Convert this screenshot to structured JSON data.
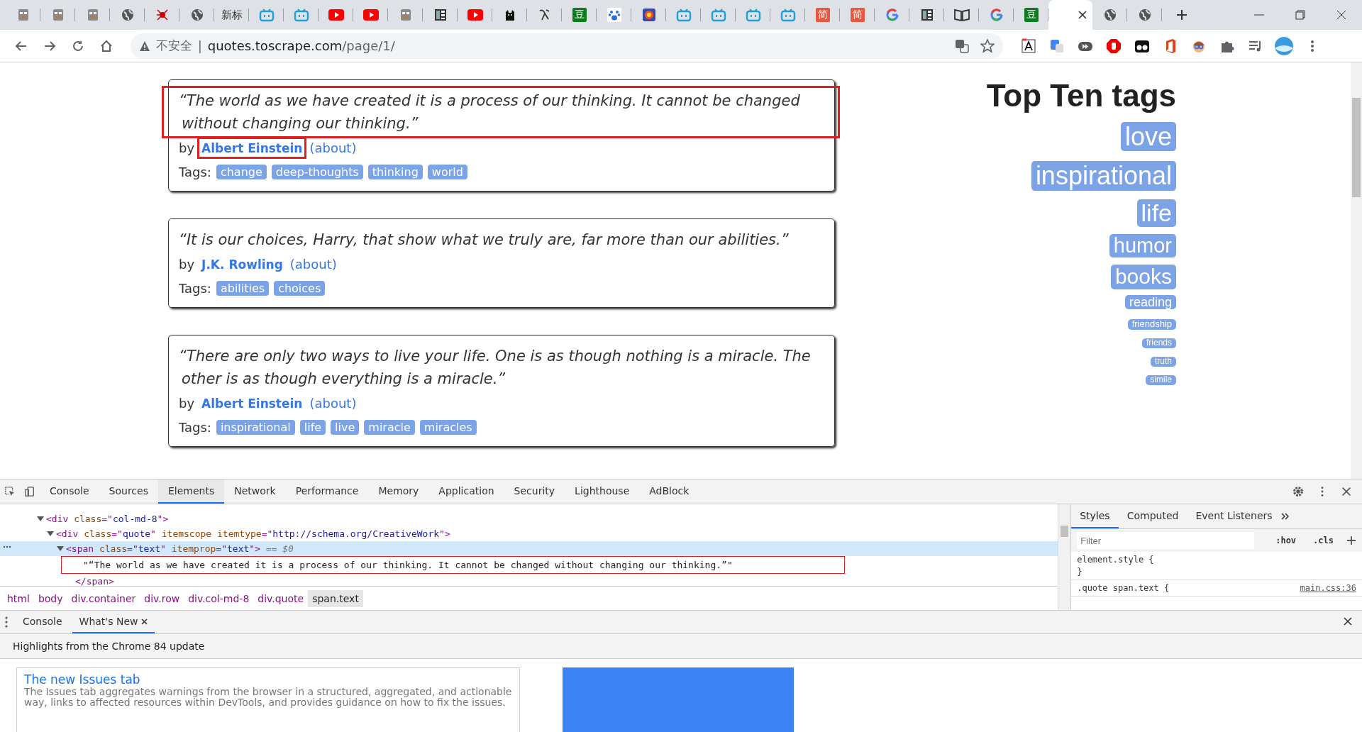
{
  "browser": {
    "tabs": [
      {
        "kind": "pixel",
        "selected": false
      },
      {
        "kind": "pixel",
        "selected": false
      },
      {
        "kind": "pixel",
        "selected": false
      },
      {
        "kind": "globe",
        "selected": false
      },
      {
        "kind": "spider",
        "selected": false
      },
      {
        "kind": "globe",
        "selected": false
      },
      {
        "kind": "text",
        "label": "新标",
        "selected": false
      },
      {
        "kind": "tv",
        "selected": false
      },
      {
        "kind": "tv",
        "selected": false
      },
      {
        "kind": "youtube",
        "selected": false
      },
      {
        "kind": "youtube",
        "selected": false
      },
      {
        "kind": "pixel",
        "selected": false
      },
      {
        "kind": "panel",
        "selected": false
      },
      {
        "kind": "youtube",
        "selected": false
      },
      {
        "kind": "cat",
        "selected": false
      },
      {
        "kind": "person",
        "selected": false
      },
      {
        "kind": "glyph",
        "glyph": "豆",
        "color": "#0a7d1c",
        "selected": false
      },
      {
        "kind": "paw",
        "selected": false
      },
      {
        "kind": "colorful",
        "selected": false
      },
      {
        "kind": "tv",
        "selected": false
      },
      {
        "kind": "tv",
        "selected": false
      },
      {
        "kind": "tv",
        "selected": false
      },
      {
        "kind": "tv",
        "selected": false
      },
      {
        "kind": "glyph",
        "glyph": "简",
        "color": "#e8573f",
        "selected": false
      },
      {
        "kind": "glyph",
        "glyph": "简",
        "color": "#e8573f",
        "selected": false
      },
      {
        "kind": "google",
        "selected": false
      },
      {
        "kind": "panel",
        "selected": false
      },
      {
        "kind": "openbook",
        "selected": false
      },
      {
        "kind": "google",
        "selected": false
      },
      {
        "kind": "glyph",
        "glyph": "豆",
        "color": "#0a7d1c",
        "selected": false
      },
      {
        "kind": "blank",
        "selected": true
      },
      {
        "kind": "globe",
        "selected": false
      },
      {
        "kind": "globe",
        "selected": false
      }
    ],
    "address": {
      "security": "不安全",
      "separator": "|",
      "host": "quotes.toscrape.com",
      "path": "/page/1/"
    },
    "extensions": [
      {
        "kind": "letter-box"
      },
      {
        "kind": "translate"
      },
      {
        "kind": "media"
      },
      {
        "kind": "stop-hand"
      },
      {
        "kind": "monkey"
      },
      {
        "kind": "office"
      },
      {
        "kind": "face"
      },
      {
        "kind": "puzzle"
      },
      {
        "kind": "playlist"
      },
      {
        "kind": "avatar"
      }
    ]
  },
  "quotes": [
    {
      "text": "“The world as we have created it is a process of our thinking. It cannot be changed without changing our thinking.”",
      "text_highlighted": true,
      "by": "by",
      "author": "Albert Einstein",
      "author_highlighted": true,
      "about": "(about)",
      "tags_label": "Tags:",
      "tags": [
        "change",
        "deep-thoughts",
        "thinking",
        "world"
      ]
    },
    {
      "text": "“It is our choices, Harry, that show what we truly are, far more than our abilities.”",
      "text_highlighted": false,
      "by": "by",
      "author": "J.K. Rowling",
      "author_highlighted": false,
      "about": "(about)",
      "tags_label": "Tags:",
      "tags": [
        "abilities",
        "choices"
      ]
    },
    {
      "text": "“There are only two ways to live your life. One is as though nothing is a miracle. The other is as though everything is a miracle.”",
      "text_highlighted": false,
      "by": "by",
      "author": "Albert Einstein",
      "author_highlighted": false,
      "about": "(about)",
      "tags_label": "Tags:",
      "tags": [
        "inspirational",
        "life",
        "live",
        "miracle",
        "miracles"
      ]
    }
  ],
  "top_tags": {
    "title": "Top Ten tags",
    "tags": [
      "love",
      "inspirational",
      "life",
      "humor",
      "books",
      "reading",
      "friendship",
      "friends",
      "truth",
      "simile"
    ]
  },
  "devtools": {
    "tabs": [
      {
        "label": "Console",
        "selected": false
      },
      {
        "label": "Sources",
        "selected": false
      },
      {
        "label": "Elements",
        "selected": true
      },
      {
        "label": "Network",
        "selected": false
      },
      {
        "label": "Performance",
        "selected": false
      },
      {
        "label": "Memory",
        "selected": false
      },
      {
        "label": "Application",
        "selected": false
      },
      {
        "label": "Security",
        "selected": false
      },
      {
        "label": "Lighthouse",
        "selected": false
      },
      {
        "label": "AdBlock",
        "selected": false
      }
    ],
    "dom_tree": [
      {
        "expanded": true,
        "selected": false,
        "highlighted": false,
        "tokens": [
          {
            "kind": "tag",
            "text": "<div "
          },
          {
            "kind": "attr",
            "text": "class"
          },
          {
            "kind": "tag",
            "text": "=\""
          },
          {
            "kind": "value",
            "text": "col-md-8"
          },
          {
            "kind": "tag",
            "text": "\">"
          }
        ],
        "children": [
          {
            "expanded": true,
            "selected": false,
            "highlighted": false,
            "tokens": [
              {
                "kind": "tag",
                "text": "<div "
              },
              {
                "kind": "attr",
                "text": "class"
              },
              {
                "kind": "tag",
                "text": "=\""
              },
              {
                "kind": "value",
                "text": "quote"
              },
              {
                "kind": "tag",
                "text": "\" "
              },
              {
                "kind": "attr",
                "text": "itemscope itemtype"
              },
              {
                "kind": "tag",
                "text": "=\""
              },
              {
                "kind": "value",
                "text": "http://schema.org/CreativeWork"
              },
              {
                "kind": "tag",
                "text": "\">"
              }
            ],
            "children": [
              {
                "expanded": true,
                "selected": true,
                "highlighted": false,
                "tokens": [
                  {
                    "kind": "tag",
                    "text": "<span "
                  },
                  {
                    "kind": "attr",
                    "text": "class"
                  },
                  {
                    "kind": "tag",
                    "text": "=\""
                  },
                  {
                    "kind": "value",
                    "text": "text"
                  },
                  {
                    "kind": "tag",
                    "text": "\" "
                  },
                  {
                    "kind": "attr",
                    "text": "itemprop"
                  },
                  {
                    "kind": "tag",
                    "text": "=\""
                  },
                  {
                    "kind": "value",
                    "text": "text"
                  },
                  {
                    "kind": "tag",
                    "text": "\">"
                  },
                  {
                    "kind": "note",
                    "text": " == $0"
                  }
                ],
                "children": [
                  {
                    "selected": false,
                    "highlighted": true,
                    "tokens": [
                      {
                        "kind": "text",
                        "text": "\"“The world as we have created it is a process of our thinking. It cannot be changed without changing our thinking.”\""
                      }
                    ]
                  }
                ],
                "closing": [
                  {
                    "kind": "tag",
                    "text": "</span>"
                  }
                ]
              }
            ]
          }
        ]
      }
    ],
    "breadcrumbs": [
      {
        "label": "html",
        "selected": false
      },
      {
        "label": "body",
        "selected": false
      },
      {
        "label": "div.container",
        "selected": false
      },
      {
        "label": "div.row",
        "selected": false
      },
      {
        "label": "div.col-md-8",
        "selected": false
      },
      {
        "label": "div.quote",
        "selected": false
      },
      {
        "label": "span.text",
        "selected": true
      }
    ],
    "styles": {
      "tabs": [
        {
          "label": "Styles",
          "selected": true
        },
        {
          "label": "Computed",
          "selected": false
        },
        {
          "label": "Event Listeners",
          "selected": false
        }
      ],
      "filter_placeholder": "Filter",
      "hov": ":hov",
      "cls": ".cls",
      "rules": [
        {
          "selector": "element.style",
          "open": "{",
          "close": "}"
        },
        {
          "selector": ".quote span.text",
          "open": "{",
          "source": "main.css:36"
        }
      ]
    },
    "drawer": {
      "tabs": [
        {
          "label": "Console",
          "selected": false,
          "closable": false
        },
        {
          "label": "What's New",
          "selected": true,
          "closable": true
        }
      ],
      "heading": "Highlights from the Chrome 84 update",
      "card": {
        "title": "The new Issues tab",
        "body": "The Issues tab aggregates warnings from the browser in a structured, aggregated, and actionable way, links to affected resources within DevTools, and provides guidance on how to fix the issues."
      }
    }
  }
}
